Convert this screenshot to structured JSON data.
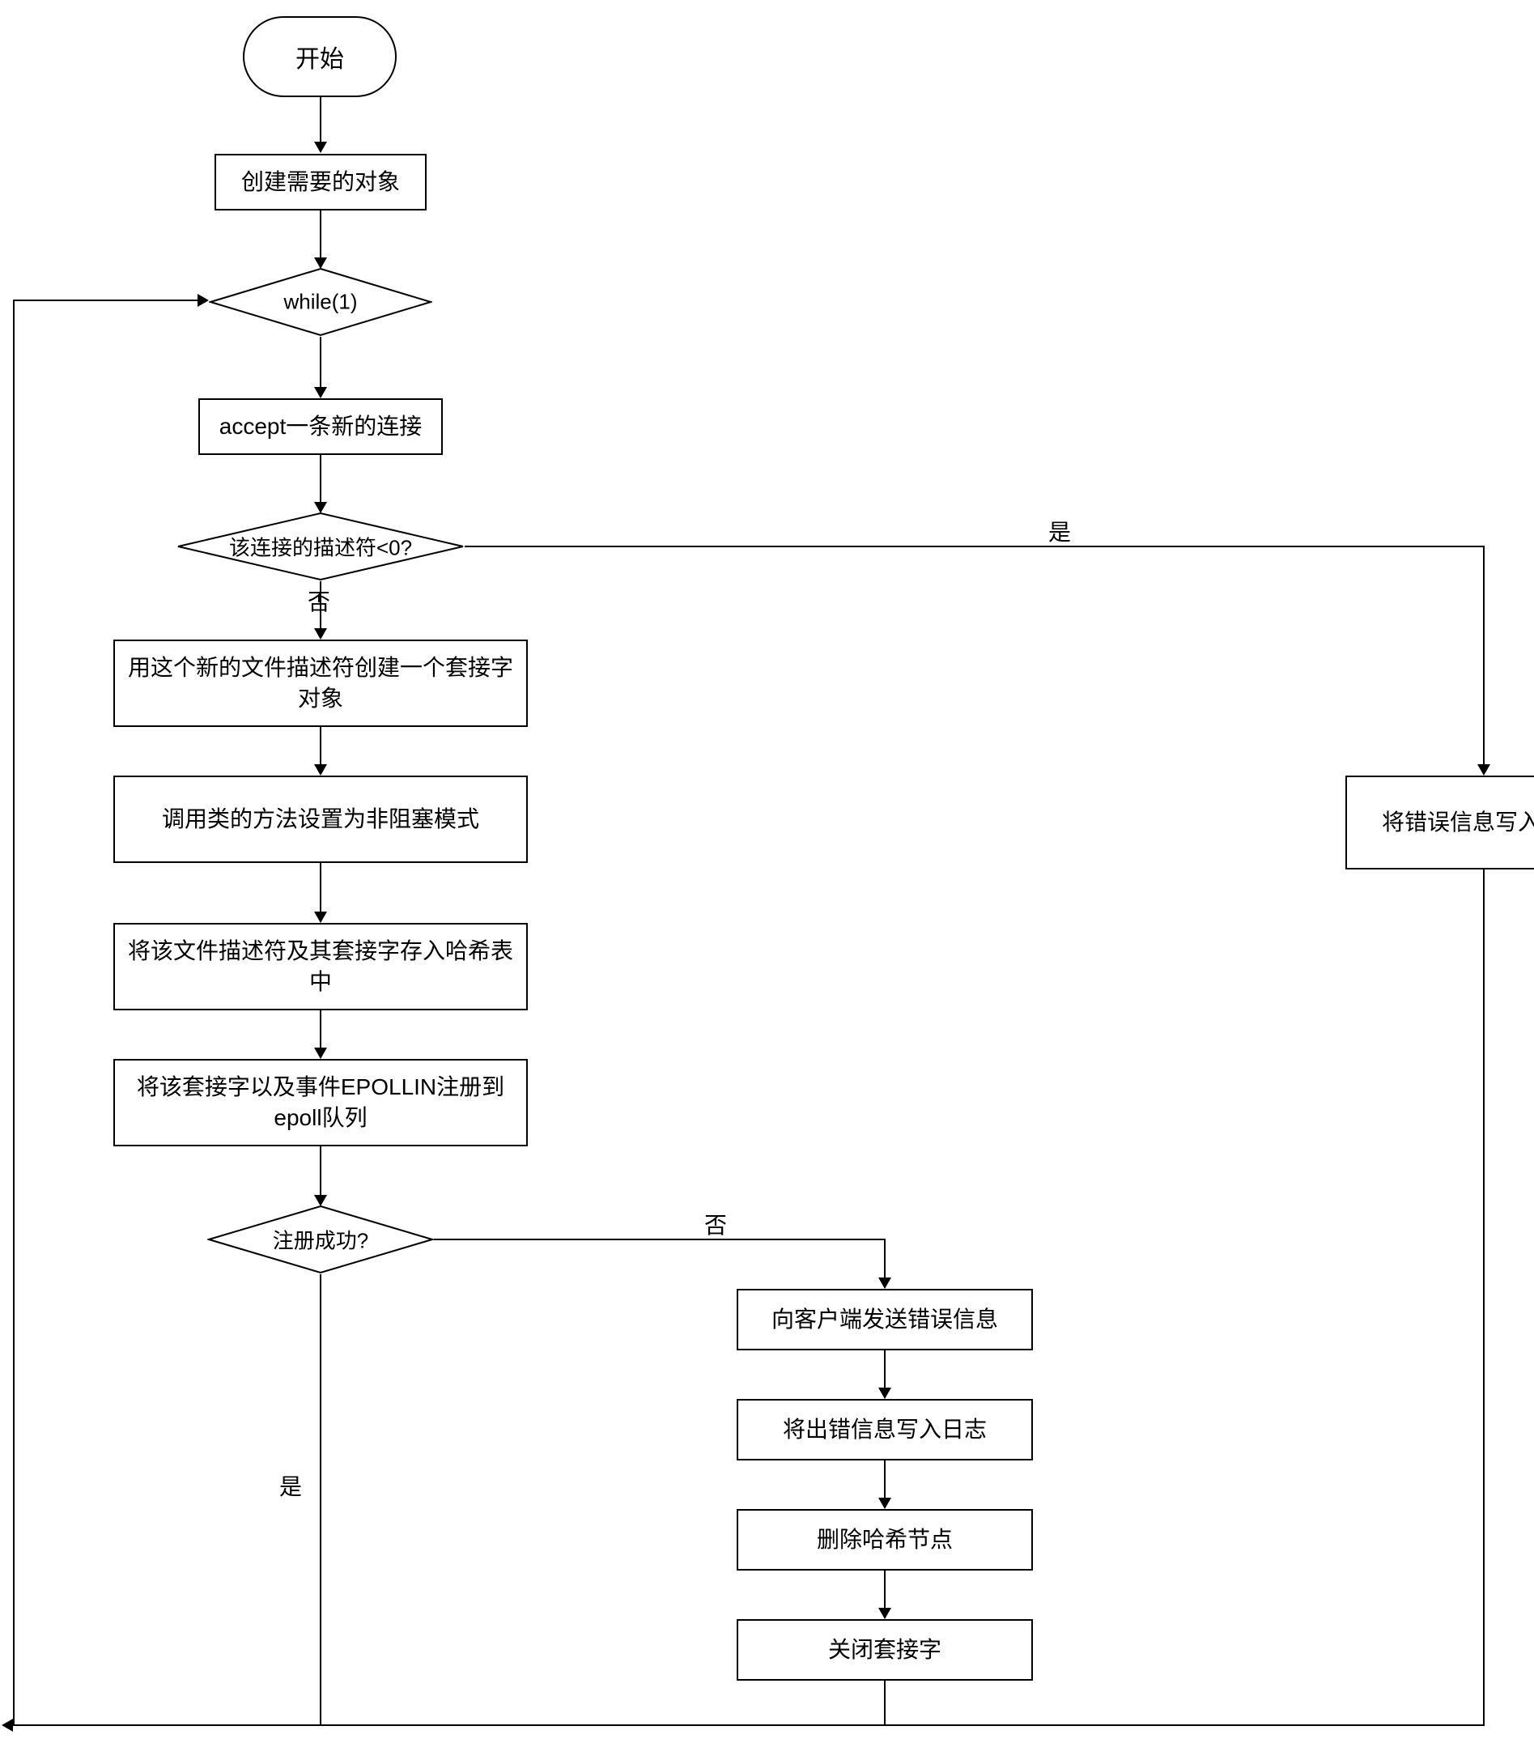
{
  "nodes": {
    "start": "开始",
    "create_obj": "创建需要的对象",
    "while": "while(1)",
    "accept": "accept一条新的连接",
    "fd_lt0": "该连接的描述符<0?",
    "new_socket": "用这个新的文件描述符创建一个套接字对象",
    "set_nonblock": "调用类的方法设置为非阻塞模式",
    "hash_store": "将该文件描述符及其套接字存入哈希表中",
    "epoll_register": "将该套接字以及事件EPOLLIN注册到epoll队列",
    "register_ok": "注册成功?",
    "err_log_right": "将错误信息写入日志",
    "send_err": "向客户端发送错误信息",
    "write_err2": "将出错信息写入日志",
    "del_hash": "删除哈希节点",
    "close_sock": "关闭套接字"
  },
  "edge_labels": {
    "yes": "是",
    "no": "否"
  },
  "chart_data": {
    "type": "flowchart",
    "nodes": [
      {
        "id": "start",
        "kind": "terminator",
        "text": "开始"
      },
      {
        "id": "create_obj",
        "kind": "process",
        "text": "创建需要的对象"
      },
      {
        "id": "while",
        "kind": "decision",
        "text": "while(1)"
      },
      {
        "id": "accept",
        "kind": "process",
        "text": "accept一条新的连接"
      },
      {
        "id": "fd_lt0",
        "kind": "decision",
        "text": "该连接的描述符<0?"
      },
      {
        "id": "new_socket",
        "kind": "process",
        "text": "用这个新的文件描述符创建一个套接字对象"
      },
      {
        "id": "set_nonblock",
        "kind": "process",
        "text": "调用类的方法设置为非阻塞模式"
      },
      {
        "id": "hash_store",
        "kind": "process",
        "text": "将该文件描述符及其套接字存入哈希表中"
      },
      {
        "id": "epoll_register",
        "kind": "process",
        "text": "将该套接字以及事件EPOLLIN注册到epoll队列"
      },
      {
        "id": "register_ok",
        "kind": "decision",
        "text": "注册成功?"
      },
      {
        "id": "err_log_right",
        "kind": "process",
        "text": "将错误信息写入日志"
      },
      {
        "id": "send_err",
        "kind": "process",
        "text": "向客户端发送错误信息"
      },
      {
        "id": "write_err2",
        "kind": "process",
        "text": "将出错信息写入日志"
      },
      {
        "id": "del_hash",
        "kind": "process",
        "text": "删除哈希节点"
      },
      {
        "id": "close_sock",
        "kind": "process",
        "text": "关闭套接字"
      }
    ],
    "edges": [
      {
        "from": "start",
        "to": "create_obj"
      },
      {
        "from": "create_obj",
        "to": "while"
      },
      {
        "from": "while",
        "to": "accept"
      },
      {
        "from": "accept",
        "to": "fd_lt0"
      },
      {
        "from": "fd_lt0",
        "to": "new_socket",
        "label": "否"
      },
      {
        "from": "fd_lt0",
        "to": "err_log_right",
        "label": "是"
      },
      {
        "from": "new_socket",
        "to": "set_nonblock"
      },
      {
        "from": "set_nonblock",
        "to": "hash_store"
      },
      {
        "from": "hash_store",
        "to": "epoll_register"
      },
      {
        "from": "epoll_register",
        "to": "register_ok"
      },
      {
        "from": "register_ok",
        "to": "while",
        "label": "是",
        "note": "loop back"
      },
      {
        "from": "register_ok",
        "to": "send_err",
        "label": "否"
      },
      {
        "from": "send_err",
        "to": "write_err2"
      },
      {
        "from": "write_err2",
        "to": "del_hash"
      },
      {
        "from": "del_hash",
        "to": "close_sock"
      },
      {
        "from": "close_sock",
        "to": "while",
        "note": "loop back via bottom"
      },
      {
        "from": "err_log_right",
        "to": "while",
        "note": "loop back via bottom"
      }
    ]
  }
}
